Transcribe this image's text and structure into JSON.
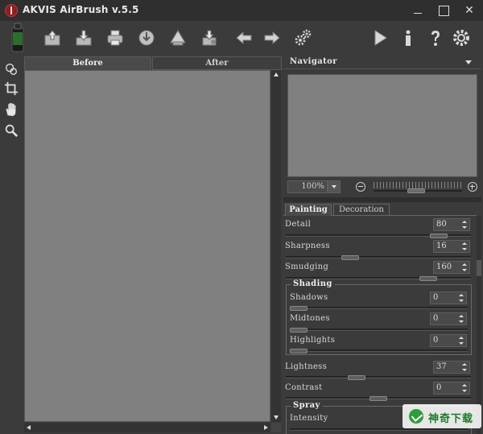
{
  "window": {
    "title": "AKVIS AirBrush v.5.5"
  },
  "toolbar": {
    "icons": [
      "airbrush-logo-icon",
      "open-image-icon",
      "save-image-icon",
      "print-icon",
      "share-icon",
      "batch-icon",
      "plugin-icon",
      "undo-icon",
      "redo-icon",
      "settings-gears-icon",
      "run-icon",
      "info-icon",
      "help-icon",
      "preferences-icon"
    ]
  },
  "tabs": {
    "before": "Before",
    "after": "After"
  },
  "navigator": {
    "title": "Navigator",
    "zoom": "100%"
  },
  "panel_tabs": {
    "painting": "Painting",
    "decoration": "Decoration"
  },
  "params": {
    "detail": {
      "label": "Detail",
      "value": "80",
      "level": 0.86
    },
    "sharpness": {
      "label": "Sharpness",
      "value": "16",
      "level": 0.33
    },
    "smudging": {
      "label": "Smudging",
      "value": "160",
      "level": 0.8
    },
    "shading": {
      "title": "Shading",
      "shadows": {
        "label": "Shadows",
        "value": "0",
        "level": 0.0
      },
      "midtones": {
        "label": "Midtones",
        "value": "0",
        "level": 0.0
      },
      "highlights": {
        "label": "Highlights",
        "value": "0",
        "level": 0.0
      }
    },
    "lightness": {
      "label": "Lightness",
      "value": "37",
      "level": 0.37
    },
    "contrast": {
      "label": "Contrast",
      "value": "0",
      "level": 0.5
    },
    "spray": {
      "title": "Spray",
      "intensity": {
        "label": "Intensity"
      }
    }
  },
  "watermark": {
    "text": "神奇下载"
  }
}
